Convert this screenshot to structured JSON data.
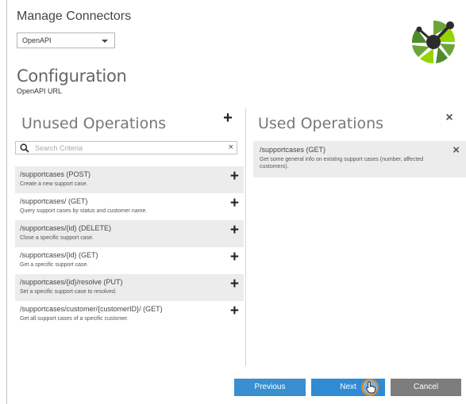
{
  "dialog": {
    "title": "Manage Connectors",
    "connector_select": {
      "value": "OpenAPI"
    }
  },
  "configuration": {
    "title": "Configuration",
    "openapi_url_label": "OpenAPI URL"
  },
  "unused_operations": {
    "title": "Unused Operations",
    "add_icon": "+",
    "search": {
      "placeholder": "Search Criteria",
      "value": "",
      "clear_icon": "×"
    },
    "items": [
      {
        "name": "/supportcases (POST)",
        "description": "Create a new support case.",
        "shaded": true
      },
      {
        "name": "/supportcases/ (GET)",
        "description": "Query support cases by status and customer name.",
        "shaded": false
      },
      {
        "name": "/supportcases/{id} (DELETE)",
        "description": "Close a specific support case.",
        "shaded": true
      },
      {
        "name": "/supportcases/{id} (GET)",
        "description": "Get a specific support case.",
        "shaded": false
      },
      {
        "name": "/supportcases/{id}/resolve (PUT)",
        "description": "Set a specific support case to resolved.",
        "shaded": true
      },
      {
        "name": "/supportcases/customer/{customerID}/ (GET)",
        "description": "Get all support cases of a specific customer.",
        "shaded": false
      }
    ]
  },
  "used_operations": {
    "title": "Used Operations",
    "close_icon": "×",
    "items": [
      {
        "name": "/supportcases (GET)",
        "description": "Get some general info on existing support cases (number, affected customers).",
        "remove_icon": "×"
      }
    ]
  },
  "buttons": {
    "previous": "Previous",
    "next": "Next",
    "cancel": "Cancel"
  },
  "icons": {
    "logo": "openapi-logo",
    "search": "search-icon",
    "cursor": "hand-pointer-icon"
  },
  "colors": {
    "primary_button": "#2f8bd4",
    "cancel_button": "#7d7d7d",
    "logo_green": "#6ba539",
    "cursor_ring": "#e8831a"
  }
}
